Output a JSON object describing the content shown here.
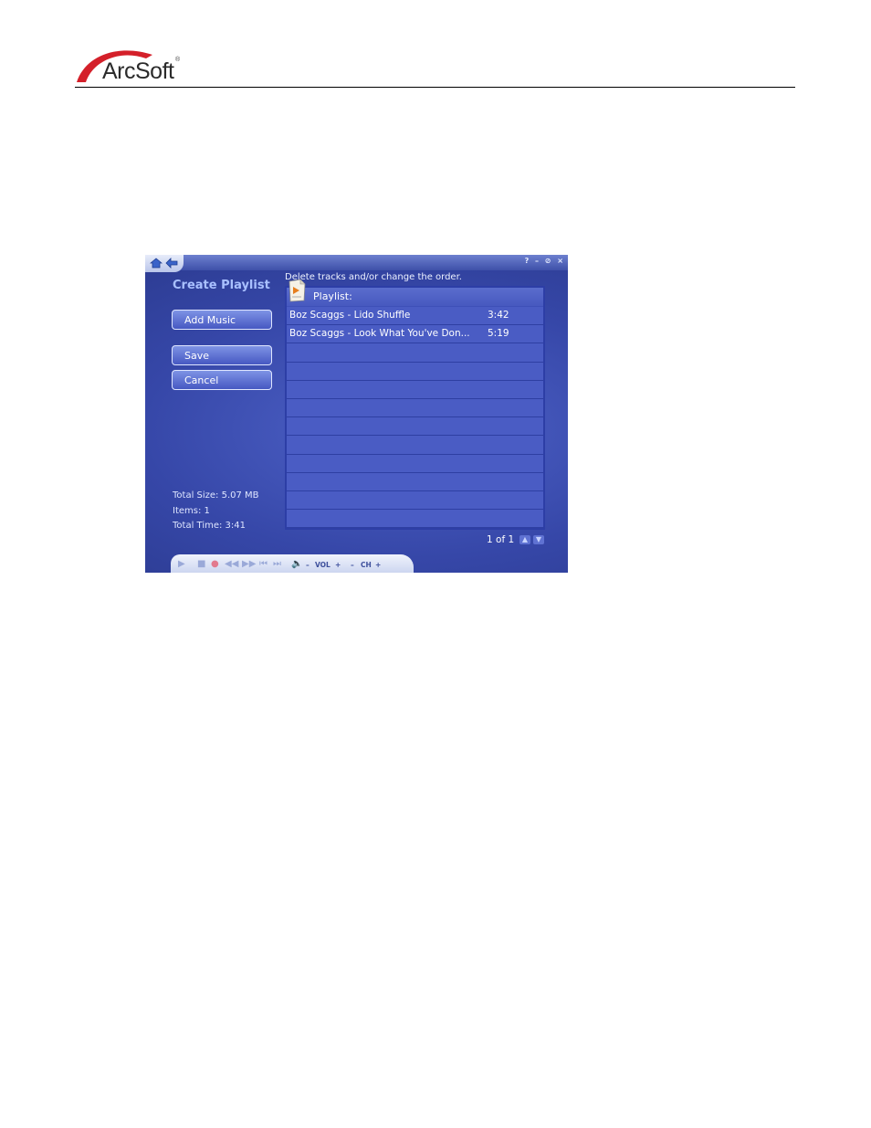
{
  "logo": {
    "text": "ArcSoft",
    "reg_mark": "®"
  },
  "app": {
    "title": "Create Playlist",
    "buttons": {
      "add_music": "Add Music",
      "save": "Save",
      "cancel": "Cancel"
    },
    "instruction": "Delete tracks and/or change the order.",
    "playlist_label": "Playlist:",
    "tracks": [
      {
        "title": "Boz Scaggs - Lido Shuffle",
        "duration": "3:42"
      },
      {
        "title": "Boz Scaggs - Look What You've Don...",
        "duration": "5:19"
      }
    ],
    "stats": {
      "total_size": "Total Size: 5.07 MB",
      "items": "Items: 1",
      "total_time": "Total Time: 3:41"
    },
    "pager": "1 of 1",
    "window_controls": [
      "?",
      "–",
      "⊘",
      "×"
    ],
    "transport": {
      "vol_label": "VOL",
      "ch_label": "CH"
    }
  },
  "colors": {
    "accent": "#3647a8",
    "title_blue": "#a9c0ff",
    "logo_red": "#d4202a"
  }
}
